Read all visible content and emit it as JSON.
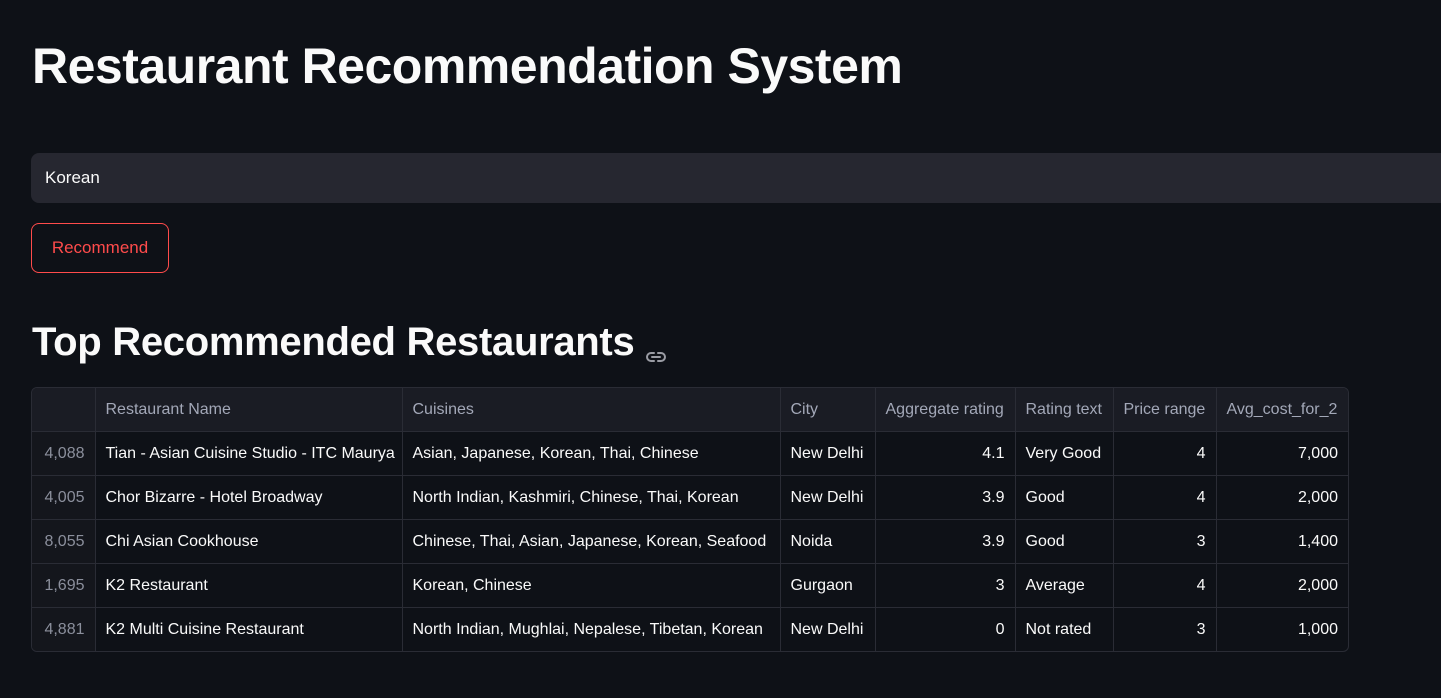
{
  "title": "Restaurant Recommendation System",
  "search": {
    "value": "Korean"
  },
  "recommend_label": "Recommend",
  "section_title": "Top Recommended Restaurants",
  "colors": {
    "background": "#0e1117",
    "accent": "#ff4b4b",
    "input": "#262730"
  },
  "table": {
    "columns": [
      "",
      "Restaurant Name",
      "Cuisines",
      "City",
      "Aggregate rating",
      "Rating text",
      "Price range",
      "Avg_cost_for_2"
    ],
    "numeric": [
      true,
      false,
      false,
      false,
      true,
      false,
      true,
      true
    ],
    "rows": [
      [
        "4,088",
        "Tian - Asian Cuisine Studio - ITC Maurya",
        "Asian, Japanese, Korean, Thai, Chinese",
        "New Delhi",
        "4.1",
        "Very Good",
        "4",
        "7,000"
      ],
      [
        "4,005",
        "Chor Bizarre - Hotel Broadway",
        "North Indian, Kashmiri, Chinese, Thai, Korean",
        "New Delhi",
        "3.9",
        "Good",
        "4",
        "2,000"
      ],
      [
        "8,055",
        "Chi Asian Cookhouse",
        "Chinese, Thai, Asian, Japanese, Korean, Seafood",
        "Noida",
        "3.9",
        "Good",
        "3",
        "1,400"
      ],
      [
        "1,695",
        "K2 Restaurant",
        "Korean, Chinese",
        "Gurgaon",
        "3",
        "Average",
        "4",
        "2,000"
      ],
      [
        "4,881",
        "K2 Multi Cuisine Restaurant",
        "North Indian, Mughlai, Nepalese, Tibetan, Korean",
        "New Delhi",
        "0",
        "Not rated",
        "3",
        "1,000"
      ]
    ]
  }
}
